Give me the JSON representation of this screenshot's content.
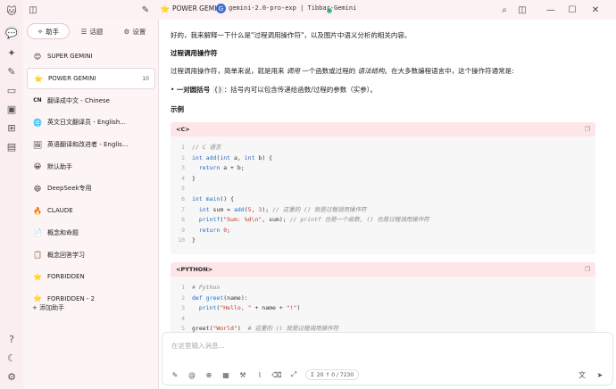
{
  "rail": {
    "icons": [
      "chat-icon",
      "sparkle-icon",
      "paint-icon",
      "translate-icon",
      "folder-icon",
      "image-icon",
      "apps-icon",
      "file-icon"
    ],
    "bottom_icons": [
      "help-icon",
      "theme-icon",
      "settings-icon"
    ]
  },
  "topbar": {
    "title": "POWER GEMINI",
    "model_badge": "G",
    "model": "gemini-2.0-pro-exp | Tibbar-Gemini"
  },
  "sidebar": {
    "tabs": [
      {
        "icon": "✧",
        "label": "助手"
      },
      {
        "icon": "☰",
        "label": "话题"
      },
      {
        "icon": "⚙",
        "label": "设置"
      }
    ],
    "assistants": [
      {
        "emoji": "😊",
        "name": "SUPER GEMINI",
        "count": ""
      },
      {
        "emoji": "⭐",
        "name": "POWER GEMINI",
        "count": "10"
      },
      {
        "emoji": "CN",
        "name": "翻译成中文 - Chinese",
        "count": ""
      },
      {
        "emoji": "🌐",
        "name": "英文日文翻译员 - English...",
        "count": ""
      },
      {
        "emoji": "🖼",
        "name": "英语翻译和改进者 - Englis...",
        "count": ""
      },
      {
        "emoji": "😀",
        "name": "默认助手",
        "count": ""
      },
      {
        "emoji": "😄",
        "name": "DeepSeek专用",
        "count": ""
      },
      {
        "emoji": "🔥",
        "name": "CLAUDE",
        "count": ""
      },
      {
        "emoji": "📄",
        "name": "概念和命题",
        "count": ""
      },
      {
        "emoji": "📋",
        "name": "概念回答学习",
        "count": ""
      },
      {
        "emoji": "⭐",
        "name": "FORBIDDEN",
        "count": ""
      },
      {
        "emoji": "⭐",
        "name": "FORBIDDEN - 2",
        "count": ""
      }
    ],
    "add_label": "+ 添加助手"
  },
  "message": {
    "intro": "好的，我来解释一下什么是\"过程调用操作符\"，以及图片中语义分析的相关内容。",
    "heading1": "过程调用操作符",
    "para1_a": "过程调用操作符，简单来说，就是用来 ",
    "para1_em1": "调用",
    "para1_b": " 一个函数或过程的 ",
    "para1_em2": "语法结构",
    "para1_c": "。在大多数编程语言中，这个操作符通常是:",
    "bullet_strong": "一对圆括号",
    "bullet_code": "()",
    "bullet_rest": "：括号内可以包含传递给函数/过程的参数（实参）。",
    "heading2": "示例",
    "c_block": {
      "lang": "<C>",
      "lines": [
        {
          "n": "1",
          "html": "<span class='cm'>// C 语言</span>"
        },
        {
          "n": "2",
          "html": "<span class='kw'>int</span> <span class='fn'>add</span>(<span class='kw'>int</span> a, <span class='kw'>int</span> b) {"
        },
        {
          "n": "3",
          "html": "  <span class='kw'>return</span> a + b;"
        },
        {
          "n": "4",
          "html": "}"
        },
        {
          "n": "5",
          "html": ""
        },
        {
          "n": "6",
          "html": "<span class='kw'>int</span> <span class='fn'>main</span>() {"
        },
        {
          "n": "7",
          "html": "  <span class='kw'>int</span> sum = <span class='fn'>add</span>(<span class='num'>5</span>, <span class='num'>3</span>); <span class='cm'>// 这里的 () 就是过程调用操作符</span>"
        },
        {
          "n": "8",
          "html": "  <span class='fn'>printf</span>(<span class='str'>\"Sum: %d\\n\"</span>, sum); <span class='cm'>// printf 也是一个函数, () 也是过程调用操作符</span>"
        },
        {
          "n": "9",
          "html": "  <span class='kw'>return</span> <span class='num'>0</span>;"
        },
        {
          "n": "10",
          "html": "}"
        }
      ]
    },
    "py_block": {
      "lang": "<PYTHON>",
      "lines": [
        {
          "n": "1",
          "html": "<span class='cm'># Python</span>"
        },
        {
          "n": "2",
          "html": "<span class='kw'>def</span> <span class='fn'>greet</span>(name):"
        },
        {
          "n": "3",
          "html": "  <span class='fn'>print</span>(<span class='str'>\"Hello, \"</span> + name + <span class='str'>\"!\"</span>)"
        },
        {
          "n": "4",
          "html": ""
        },
        {
          "n": "5",
          "html": "greet(<span class='str'>\"World\"</span>)  <span class='cm'># 这里的 () 就是过程调用操作符</span>"
        }
      ]
    }
  },
  "input": {
    "placeholder": "在这里输入消息...",
    "token_count": "20 ↑ 0 / 7230"
  }
}
